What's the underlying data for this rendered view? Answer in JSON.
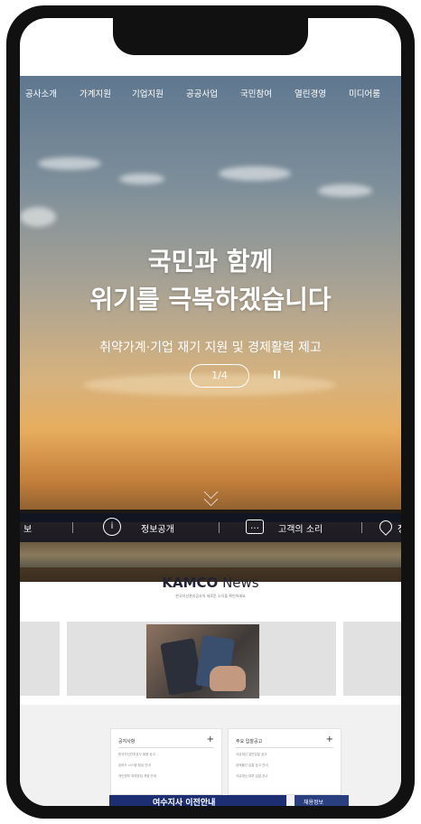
{
  "nav": {
    "items": [
      "공사소개",
      "가계지원",
      "기업지원",
      "공공사업",
      "국민참여",
      "열린경영",
      "미디어룸"
    ]
  },
  "hero": {
    "title_line1": "국민과 함께",
    "title_line2": "위기를 극복하겠습니다",
    "subtitle": "취약가계·기업 재기 지원 및 경제활력 제고",
    "pager": "1/4",
    "pause_symbol": "II"
  },
  "quickbar": {
    "items": [
      {
        "label": "보"
      },
      {
        "icon": "info-icon",
        "label": "정보공개"
      },
      {
        "icon": "chat-icon",
        "label": "고객의 소리"
      },
      {
        "icon": "location-pin-icon",
        "label": "정"
      }
    ]
  },
  "news": {
    "title_bold": "KAMCO",
    "title_rest": " News",
    "subtitle": "한국자산관리공사의 새로운 소식을 확인하세요"
  },
  "notices": {
    "left_title": "공지사항",
    "right_title": "주요 입찰공고",
    "plus": "+",
    "left_items": [
      "한국자산관리공사 채용 공고",
      "온비드 시스템 점검 안내",
      "개인정보 처리방침 개정 안내"
    ],
    "right_items": [
      "국유재산 일반입찰 공고",
      "공매물건 입찰 공고 안내",
      "국유재산 대부 입찰 공고"
    ]
  },
  "banner": {
    "text": "여수지사 이전안내",
    "side_text": "채용정보"
  }
}
